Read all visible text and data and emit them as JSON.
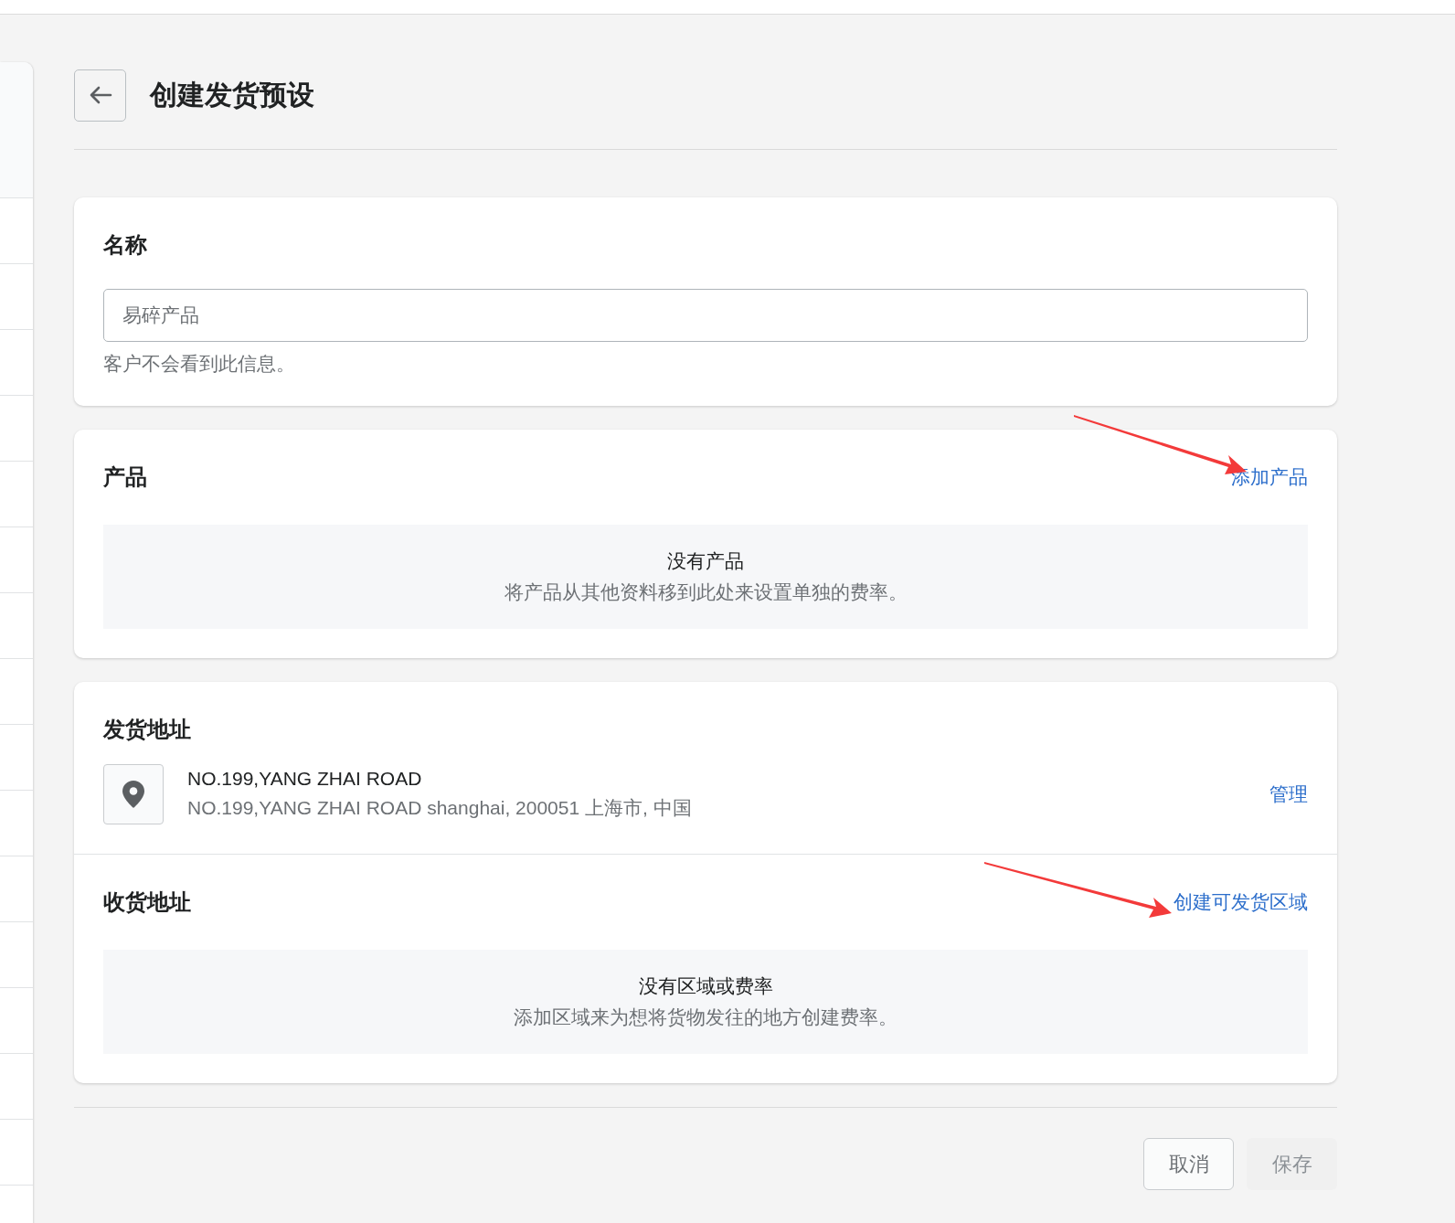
{
  "page": {
    "title": "创建发货预设"
  },
  "name_card": {
    "heading": "名称",
    "input": {
      "placeholder": "易碎产品"
    },
    "hint": "客户不会看到此信息。"
  },
  "products_card": {
    "heading": "产品",
    "action": "添加产品",
    "empty": {
      "title": "没有产品",
      "text": "将产品从其他资料移到此处来设置单独的费率。"
    }
  },
  "shipping_card": {
    "origin": {
      "heading": "发货地址",
      "address_name": "NO.199,YANG ZHAI ROAD",
      "address_line": "NO.199,YANG ZHAI ROAD shanghai, 200051 上海市, 中国",
      "action": "管理"
    },
    "destination": {
      "heading": "收货地址",
      "action": "创建可发货区域",
      "empty": {
        "title": "没有区域或费率",
        "text": "添加区域来为想将货物发往的地方创建费率。"
      }
    }
  },
  "footer": {
    "buttons": [
      {
        "label": "取消",
        "disabled": false
      },
      {
        "label": "保存",
        "disabled": true
      }
    ]
  }
}
